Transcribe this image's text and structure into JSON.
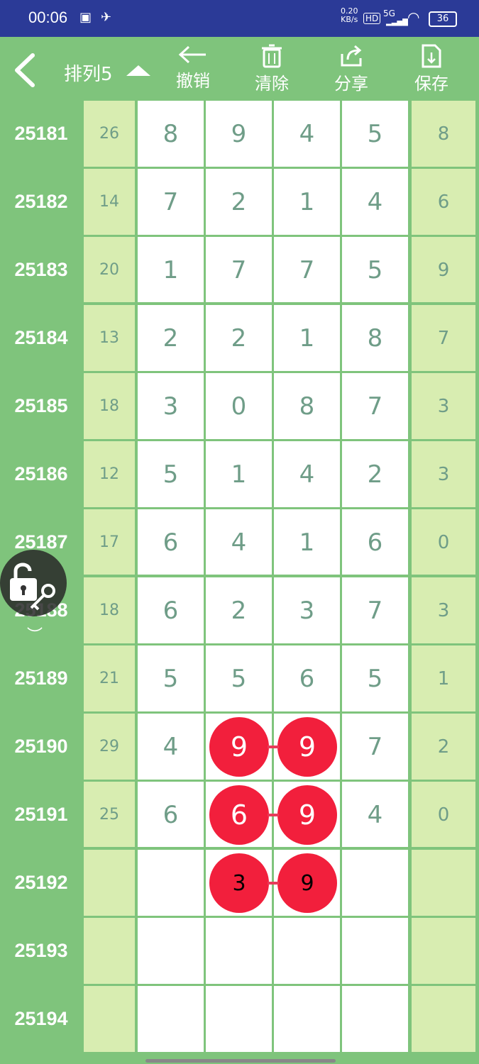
{
  "status": {
    "time": "00:06",
    "network": "5G",
    "hd": "HD",
    "speed_top": "0.20",
    "speed_unit": "KB/s",
    "battery": "36"
  },
  "header": {
    "title": "排列5"
  },
  "toolbar": {
    "undo": "撤销",
    "clear": "清除",
    "share": "分享",
    "save": "保存"
  },
  "rows": [
    {
      "issue": "25181",
      "sum": "26",
      "digits": [
        "8",
        "9",
        "4",
        "5"
      ],
      "last": "8"
    },
    {
      "issue": "25182",
      "sum": "14",
      "digits": [
        "7",
        "2",
        "1",
        "4"
      ],
      "last": "6"
    },
    {
      "issue": "25183",
      "sum": "20",
      "digits": [
        "1",
        "7",
        "7",
        "5"
      ],
      "last": "9"
    },
    {
      "issue": "25184",
      "sum": "13",
      "digits": [
        "2",
        "2",
        "1",
        "8"
      ],
      "last": "7"
    },
    {
      "issue": "25185",
      "sum": "18",
      "digits": [
        "3",
        "0",
        "8",
        "7"
      ],
      "last": "3"
    },
    {
      "issue": "25186",
      "sum": "12",
      "digits": [
        "5",
        "1",
        "4",
        "2"
      ],
      "last": "3"
    },
    {
      "issue": "25187",
      "sum": "17",
      "digits": [
        "6",
        "4",
        "1",
        "6"
      ],
      "last": "0"
    },
    {
      "issue": "25188",
      "sum": "18",
      "digits": [
        "6",
        "2",
        "3",
        "7"
      ],
      "last": "3"
    },
    {
      "issue": "25189",
      "sum": "21",
      "digits": [
        "5",
        "5",
        "6",
        "5"
      ],
      "last": "1"
    },
    {
      "issue": "25190",
      "sum": "29",
      "digits": [
        "4",
        "9",
        "9",
        "7"
      ],
      "last": "2"
    },
    {
      "issue": "25191",
      "sum": "25",
      "digits": [
        "6",
        "6",
        "9",
        "4"
      ],
      "last": "0"
    },
    {
      "issue": "25192",
      "sum": "",
      "digits": [
        "",
        "3",
        "9",
        ""
      ],
      "last": ""
    },
    {
      "issue": "25193",
      "sum": "",
      "digits": [
        "",
        "",
        "",
        ""
      ],
      "last": ""
    },
    {
      "issue": "25194",
      "sum": "",
      "digits": [
        "",
        "",
        "",
        ""
      ],
      "last": ""
    }
  ],
  "balls": [
    {
      "row": 9,
      "col": 1
    },
    {
      "row": 9,
      "col": 2
    },
    {
      "row": 10,
      "col": 1
    },
    {
      "row": 10,
      "col": 2
    },
    {
      "row": 11,
      "col": 1
    },
    {
      "row": 11,
      "col": 2
    }
  ],
  "colors": {
    "green": "#7fc47c",
    "light_green": "#d8edb1",
    "digit": "#6f9d88",
    "ball": "#f21f3c",
    "status_bg": "#2b3a97"
  }
}
